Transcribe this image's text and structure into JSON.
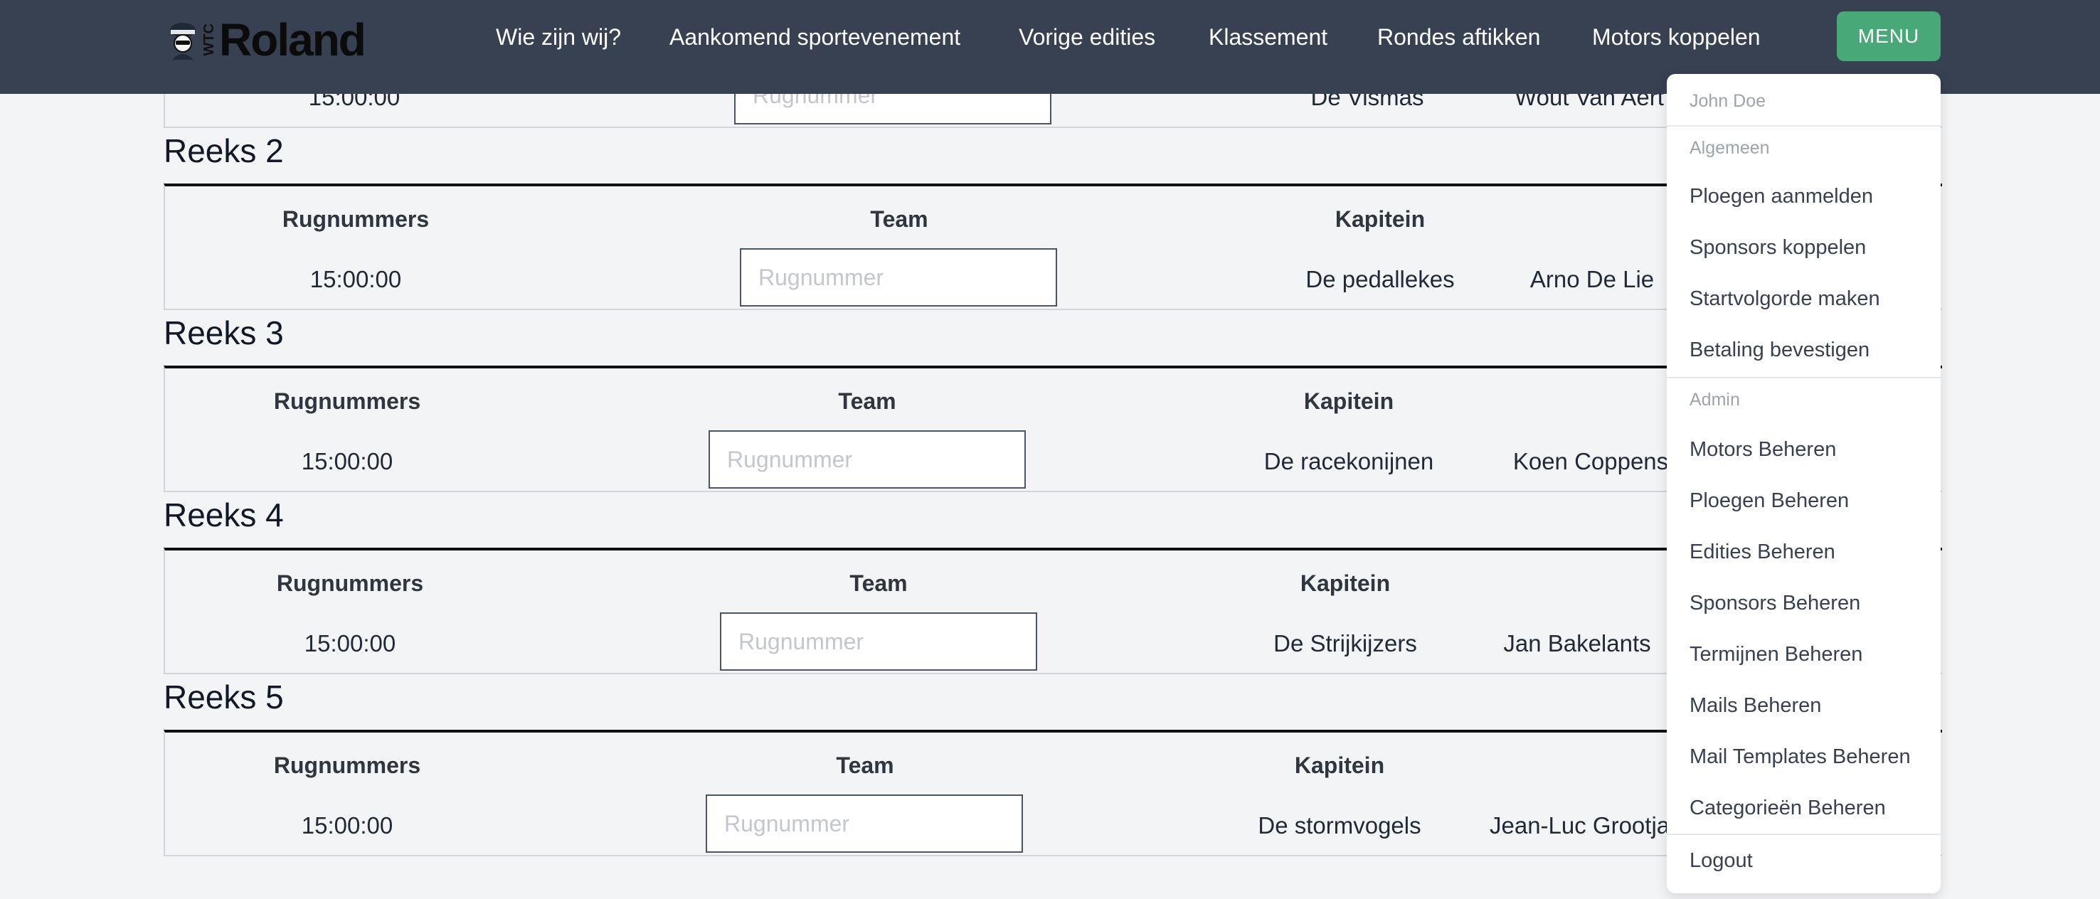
{
  "nav": {
    "logo_text": "Roland",
    "logo_small": "WTC",
    "links": [
      "Wie zijn wij?",
      "Aankomend sportevenement",
      "Vorige edities",
      "Klassement",
      "Rondes aftikken",
      "Motors koppelen"
    ],
    "menu_label": "MENU"
  },
  "partial_row": {
    "time": "15:00:00",
    "placeholder": "Rugnummer",
    "team": "De Vismas",
    "captain": "Wout Van Aert"
  },
  "columns": {
    "rugnummers": "Rugnummers",
    "team": "Team",
    "kapitein": "Kapitein"
  },
  "reeksen": [
    {
      "title": "Reeks 2",
      "time": "15:00:00",
      "placeholder": "Rugnummer",
      "team": "De pedallekes",
      "captain": "Arno De Lie"
    },
    {
      "title": "Reeks 3",
      "time": "15:00:00",
      "placeholder": "Rugnummer",
      "team": "De racekonijnen",
      "captain": "Koen Coppens"
    },
    {
      "title": "Reeks 4",
      "time": "15:00:00",
      "placeholder": "Rugnummer",
      "team": "De Strijkijzers",
      "captain": "Jan Bakelants"
    },
    {
      "title": "Reeks 5",
      "time": "15:00:00",
      "placeholder": "Rugnummer",
      "team": "De stormvogels",
      "captain": "Jean-Luc Grootjans"
    }
  ],
  "dropdown": {
    "user": "John Doe",
    "general_header": "Algemeen",
    "general": [
      "Ploegen aanmelden",
      "Sponsors koppelen",
      "Startvolgorde maken",
      "Betaling bevestigen"
    ],
    "admin_header": "Admin",
    "admin": [
      "Motors Beheren",
      "Ploegen Beheren",
      "Edities Beheren",
      "Sponsors Beheren",
      "Termijnen Beheren",
      "Mails Beheren",
      "Mail Templates Beheren",
      "Categorieën Beheren"
    ],
    "logout": "Logout"
  },
  "colors": {
    "navbar": "#374151",
    "menu_button": "#48a878",
    "background": "#f3f4f6"
  }
}
